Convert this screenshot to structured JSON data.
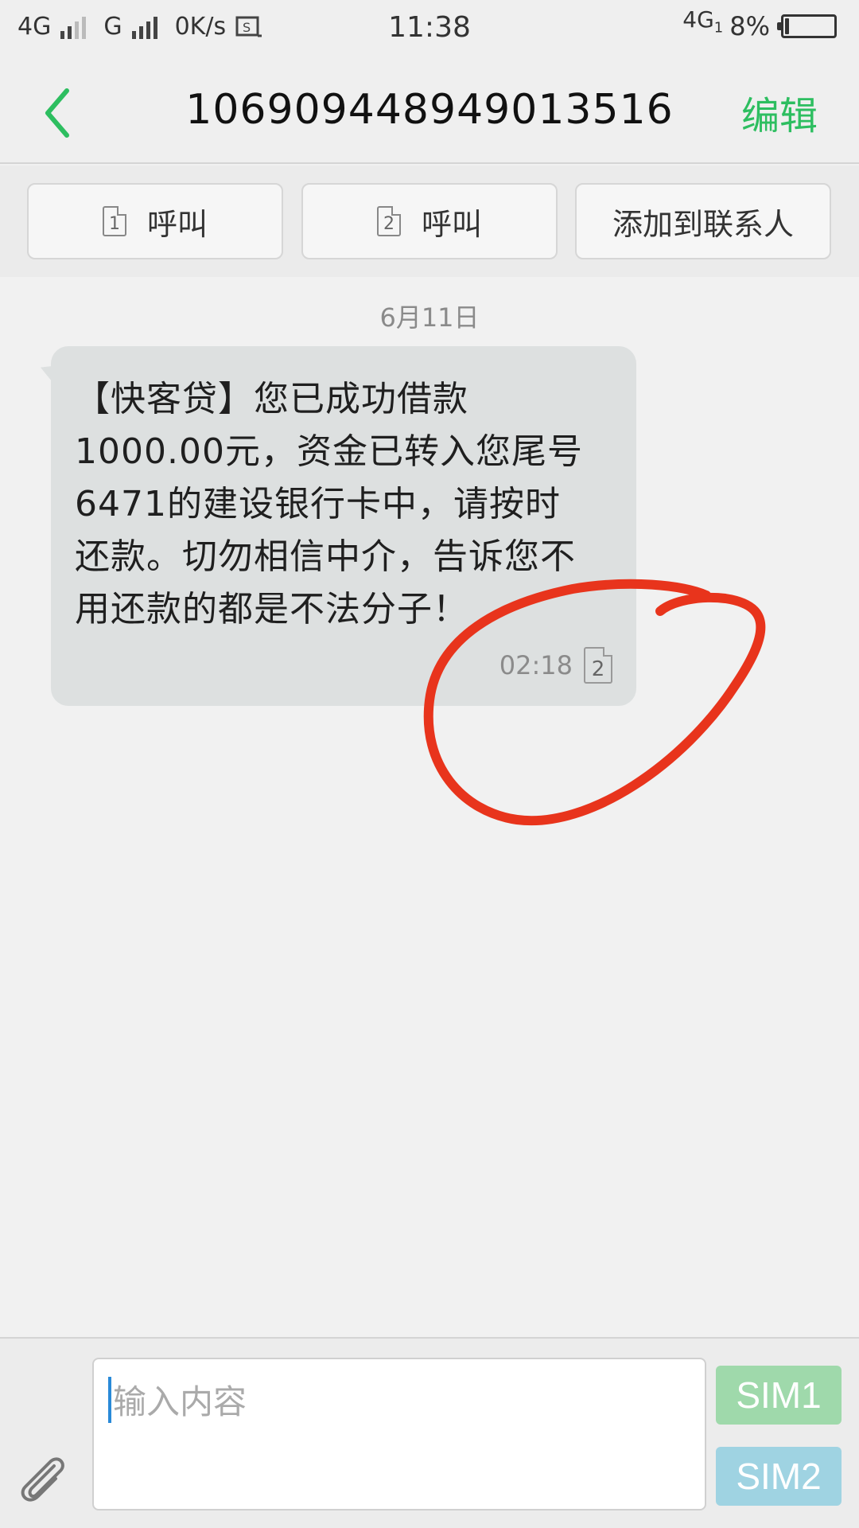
{
  "status_bar": {
    "network1": "4G",
    "network2": "G",
    "speed": "0K/s",
    "time": "11:38",
    "network_right": "4G",
    "network_right_sub": "1",
    "battery_percent": "8%",
    "battery_level": 0.08
  },
  "header": {
    "title": "1069094489490135 16",
    "edit_label": "编辑",
    "accent_color": "#2dbe60"
  },
  "actions": {
    "call1": {
      "sim": "1",
      "label": "呼叫"
    },
    "call2": {
      "sim": "2",
      "label": "呼叫"
    },
    "add_contact": "添加到联系人"
  },
  "conversation": {
    "date": "6月11日",
    "messages": [
      {
        "lines": [
          "【快客贷】您已成功借款",
          "1000.00元，资金已转入您尾号",
          "6471的建设银行卡中，请按时",
          "还款。切勿相信中介，告诉您不",
          "用还款的都是不法分子！"
        ],
        "time": "02:18",
        "sim": "2"
      }
    ]
  },
  "composer": {
    "placeholder": "输入内容",
    "sim1_label": "SIM1",
    "sim2_label": "SIM2",
    "sim1_color": "#9fd9ab",
    "sim2_color": "#9fd3e2"
  },
  "annotation_color": "#e8341c"
}
